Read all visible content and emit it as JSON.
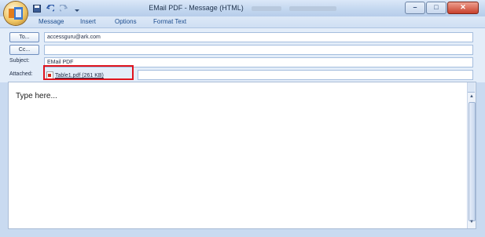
{
  "window": {
    "title": "EMail PDF - Message (HTML)"
  },
  "ribbon": {
    "tabs": [
      "Message",
      "Insert",
      "Options",
      "Format Text"
    ]
  },
  "header": {
    "to_button": "To...",
    "to_value": "accessguru@ark.com",
    "cc_button": "Cc...",
    "cc_value": "",
    "subject_label": "Subject:",
    "subject_value": "EMail PDF",
    "attached_label": "Attached:",
    "attachment": "Table1.pdf (261 KB)"
  },
  "body": {
    "text": "Type here..."
  },
  "colors": {
    "highlight": "#e0141e",
    "chrome": "#c9daf0"
  },
  "icons": [
    "office-orb-icon",
    "save-icon",
    "undo-icon",
    "redo-icon",
    "customize-icon",
    "minimize-icon",
    "maximize-icon",
    "close-icon",
    "help-icon",
    "pdf-icon",
    "ruler-icon"
  ]
}
